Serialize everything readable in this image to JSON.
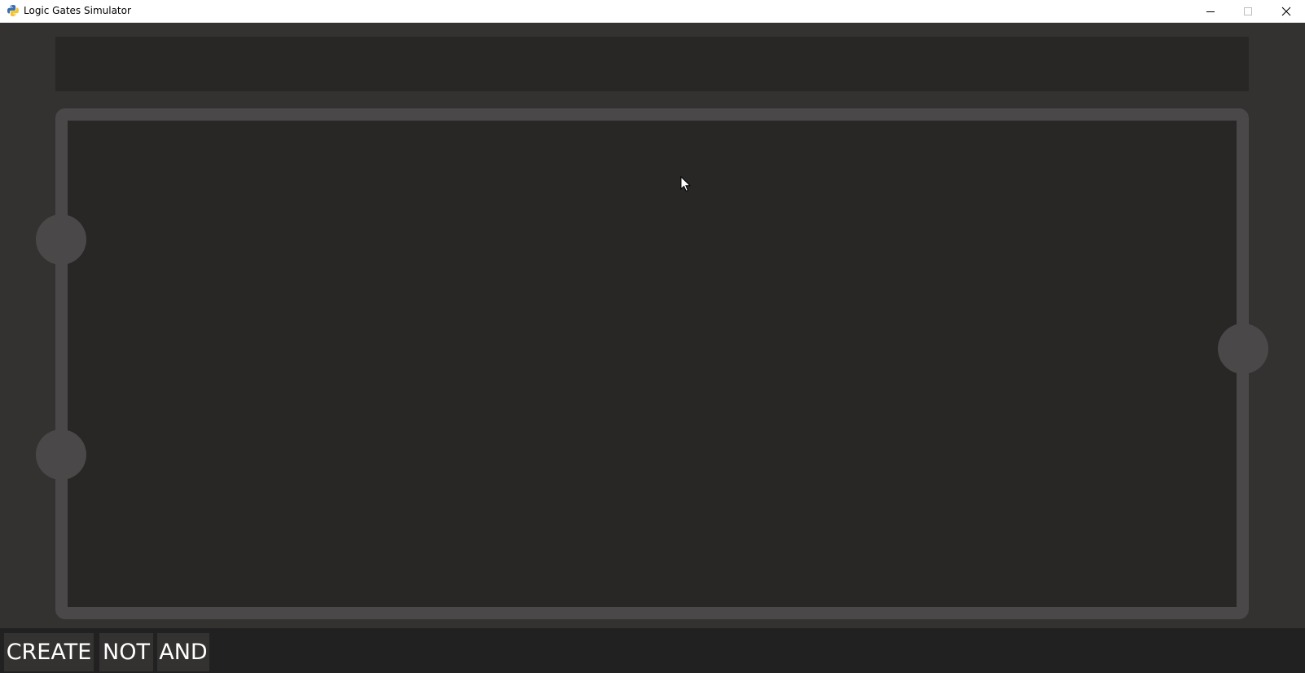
{
  "window": {
    "title": "Logic Gates Simulator",
    "icon": "python-icon",
    "controls": [
      "minimize-icon",
      "maximize-icon",
      "close-icon"
    ]
  },
  "toolbar": {
    "create_label": "CREATE",
    "not_label": "NOT",
    "and_label": "AND"
  },
  "colors": {
    "background": "#333231",
    "canvas": "#282726",
    "board_border": "#4a4848",
    "toolbar": "#222121",
    "button": "#333231",
    "button_text": "#ffffff"
  }
}
